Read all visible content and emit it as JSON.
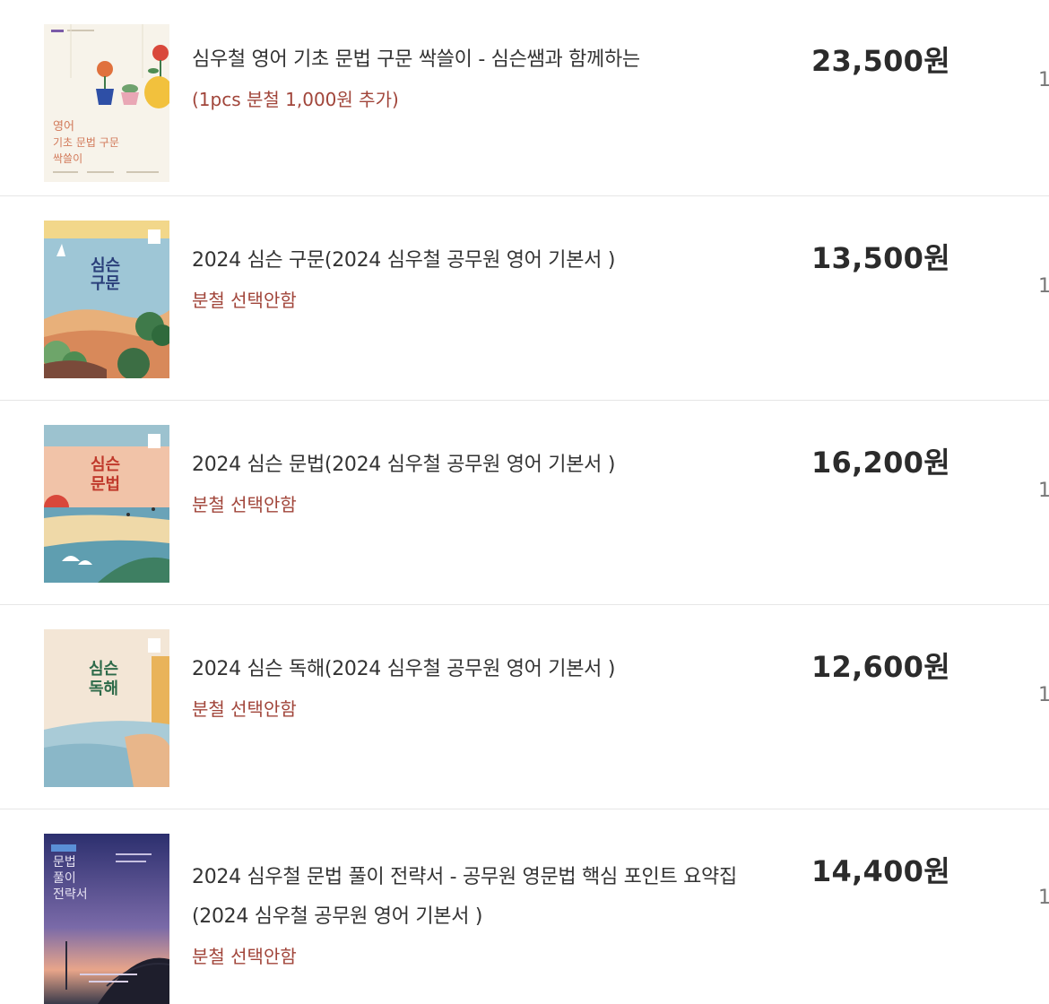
{
  "cart": {
    "items": [
      {
        "title": "심우철 영어 기초 문법 구문 싹쓸이 - 심슨쌤과 함께하는",
        "title_line2": "",
        "option": "(1pcs 분철 1,000원 추가)",
        "price": "23,500",
        "currency": "원",
        "qty": "1",
        "cover_icon": "book-cover-flowers"
      },
      {
        "title": "2024 심슨 구문(2024 심우철 공무원 영어 기본서 )",
        "title_line2": "",
        "option": "분철 선택안함",
        "price": "13,500",
        "currency": "원",
        "qty": "1",
        "cover_icon": "book-cover-landscape-green"
      },
      {
        "title": "2024 심슨 문법(2024 심우철 공무원 영어 기본서 )",
        "title_line2": "",
        "option": "분철 선택안함",
        "price": "16,200",
        "currency": "원",
        "qty": "1",
        "cover_icon": "book-cover-sunset-sea"
      },
      {
        "title": "2024 심슨 독해(2024 심우철 공무원 영어 기본서 )",
        "title_line2": "",
        "option": "분철 선택안함",
        "price": "12,600",
        "currency": "원",
        "qty": "1",
        "cover_icon": "book-cover-beach"
      },
      {
        "title": "2024 심우철 문법 풀이 전략서 - 공무원 영문법 핵심 포인트 요약집",
        "title_line2": "(2024 심우철 공무원 영어 기본서 )",
        "option": "분철 선택안함",
        "price": "14,400",
        "currency": "원",
        "qty": "1",
        "cover_icon": "book-cover-night-bridge"
      }
    ],
    "covers": {
      "item0": {
        "line1": "영어",
        "line2": "기초 문법 구문",
        "line3": "싹쓸이"
      },
      "item1": {
        "line1": "심슨",
        "line2": "구문"
      },
      "item2": {
        "line1": "심슨",
        "line2": "문법"
      },
      "item3": {
        "line1": "심슨",
        "line2": "독해"
      },
      "item4": {
        "line1": "문법",
        "line2": "풀이",
        "line3": "전략서"
      }
    },
    "colors": {
      "option_text": "#a1453a",
      "price_text": "#2b2b2b",
      "title_text": "#333333",
      "divider": "#e6e6e6"
    }
  }
}
